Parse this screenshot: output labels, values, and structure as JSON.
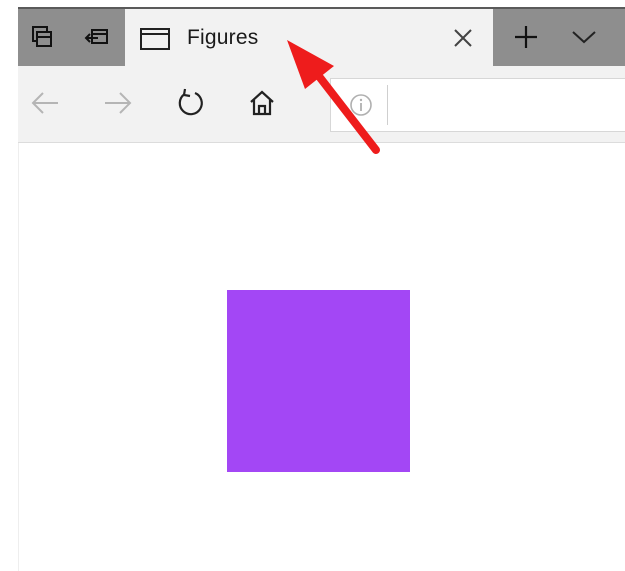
{
  "tab": {
    "title": "Figures",
    "close_icon": "close-icon",
    "favicon": "window-icon"
  },
  "tabstrip": {
    "left_buttons": [
      "tab-set-aside-icon",
      "tabs-restore-icon"
    ],
    "new_tab_icon": "plus-icon",
    "tab_list_icon": "chevron-down-icon"
  },
  "nav": {
    "back_icon": "back-arrow-icon",
    "forward_icon": "forward-arrow-icon",
    "refresh_icon": "refresh-icon",
    "home_icon": "home-icon",
    "address_info_icon": "info-icon",
    "address_value": ""
  },
  "content": {
    "square_color": "#a347f5"
  },
  "annotation": {
    "arrow_color": "#ee1c1c"
  },
  "colors": {
    "tabstrip": "#8e8e8e",
    "active_tab": "#f2f2f2",
    "navbar": "#f2f2f2"
  }
}
